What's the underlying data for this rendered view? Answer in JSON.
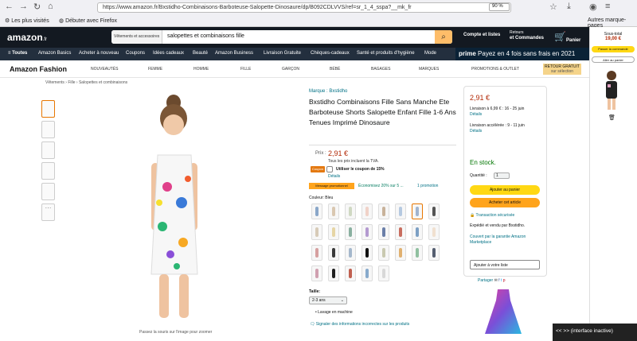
{
  "browser": {
    "url": "https://www.amazon.fr/Bxstidho-Combinaisons-Barboteuse-Salopette-Dinosaure/dp/B092CDLVVS/ref=sr_1_4_sspa?__mk_fr",
    "zoom": "90 %",
    "bookmarks": [
      "Les plus visités",
      "Débuter avec Firefox"
    ],
    "other_bookmarks": "Autres marque-pages"
  },
  "header": {
    "logo": "amazon",
    "logo_suffix": ".fr",
    "search_category": "Vêtements et accessoires",
    "search_value": "salopettes et combinaisons fille",
    "account": "Compte et listes",
    "returns": "Retours",
    "orders": "et Commandes",
    "cart_count": "0",
    "cart_label": "Panier"
  },
  "nav": {
    "items": [
      "≡ Toutes",
      "Amazon Basics",
      "Acheter à nouveau",
      "Coupons",
      "Idées cadeaux",
      "Beauté",
      "Amazon Business",
      "Livraison Gratuite",
      "Chèques-cadeaux",
      "Santé et produits d'hygiène",
      "Mode"
    ],
    "prime": "prime",
    "banner": "Payez en 4 fois sans frais en 2021"
  },
  "fashion": {
    "logo": "Amazon Fashion",
    "items": [
      "NOUVEAUTÉS",
      "FEMME",
      "HOMME",
      "FILLE",
      "GARÇON",
      "BÉBÉ",
      "BAGAGES",
      "MARQUES",
      "PROMOTIONS & OUTLET"
    ],
    "retour": "RETOUR GRATUIT",
    "retour_sub": "sur sélection"
  },
  "breadcrumb": "Vêtements › Fille › Salopettes et combinaisons",
  "gallery": {
    "caption": "Passez la souris sur l'image pour zoomer"
  },
  "product": {
    "brand": "Marque : Bxstidho",
    "title": "Bxstidho Combinaisons Fille Sans Manche Ete Barboteuse Shorts Salopette Enfant Fille 1-6 Ans Tenues Imprimé Dinosaure",
    "price_label": "Prix :",
    "price": "2,91 €",
    "tva": "Tous les prix incluent la TVA.",
    "coupon_badge": "Coupon",
    "coupon_text": "Utiliser le coupon de 15%",
    "details": "Détails",
    "promo_badge": "Message promotionnel",
    "promo_text": "Économisez 20% sur 5 ...",
    "promo_link": "1 promotion",
    "color_label": "Couleur: Bleu",
    "swatch_colors": [
      "#8aa7c9",
      "#d9c7b0",
      "#cfd8c2",
      "#f0d2c8",
      "#c8b29a",
      "#b5c9e0",
      "#a0b4cf",
      "#555",
      "#d7cbb8",
      "#e6d5a5",
      "#8ab0a0",
      "#b49ad0",
      "#6b7fa8",
      "#c86d5e",
      "#7da0c4",
      "#f0e0d0",
      "#d6a0a0",
      "#3a3a3a",
      "#a5b8cc",
      "#111",
      "#c9c9b0",
      "#e0b070",
      "#90c0a0",
      "#555e70",
      "#d0a0b0",
      "#202020",
      "#c06050",
      "#88aacc",
      "#d8d8d8"
    ],
    "size_label": "Taille:",
    "size_value": "2-3 ans",
    "lavage": "Lavage en machine",
    "signal": "Signaler des informations incorrectes sur les produits"
  },
  "buybox": {
    "price": "2,91 €",
    "livraison": "Livraison à 6,99 € : 16 - 25 juin",
    "details1": "Détails",
    "livraison_acc": "Livraison accélérée : 9 - 11 juin",
    "details2": "Détails",
    "stock": "En stock.",
    "qty_label": "Quantité :",
    "qty": "1",
    "add_cart": "Ajouter au panier",
    "buy_now": "Acheter cet article",
    "secure": "Transaction sécurisée",
    "seller": "Expédié et vendu par Bxstidho.",
    "guarantee": "Couvert par la garantie Amazon Marketplace",
    "add_list": "Ajouter à votre liste",
    "share": "Partager"
  },
  "side": {
    "subtotal_label": "Sous-total",
    "subtotal": "19,00 €",
    "checkout": "Passer la commande",
    "view_cart": "Aller au panier"
  },
  "overlay": {
    "text": "<<  >> (interface inactive)"
  },
  "colors": {
    "amazon_dark": "#131921",
    "amazon_nav": "#232f3e",
    "accent": "#febd69",
    "price": "#b12704",
    "link": "#007185",
    "stock": "#007600"
  }
}
